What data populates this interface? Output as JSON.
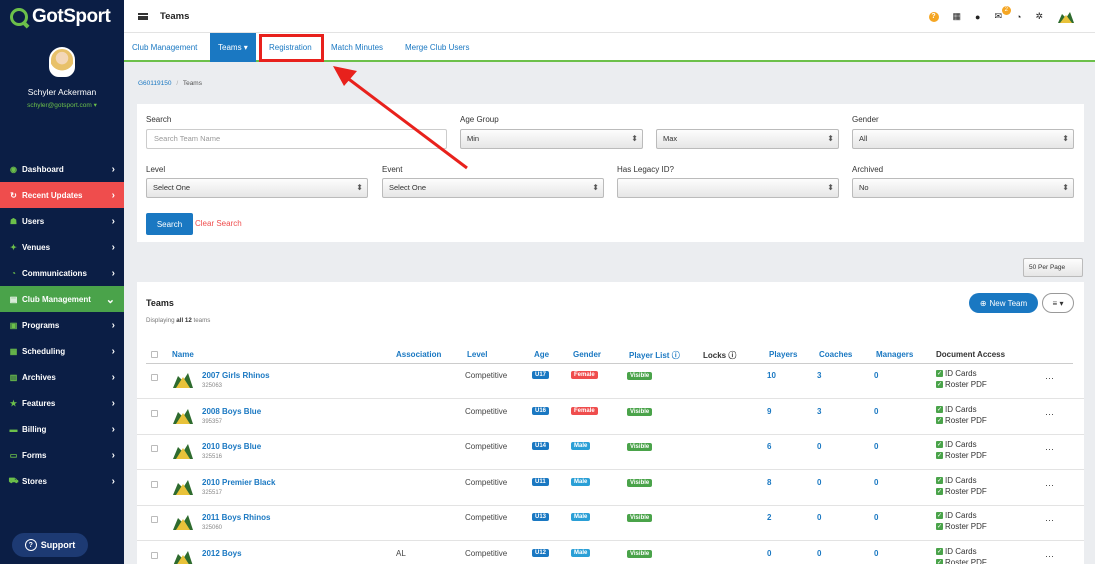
{
  "brand": {
    "logo_text": "GotSport",
    "accent": "#6cc04a"
  },
  "user": {
    "name": "Schyler Ackerman",
    "email": "schyler@gotsport.com ▾"
  },
  "sidebar": {
    "items": [
      {
        "label": "Dashboard",
        "icon": "dashboard-icon",
        "state": "normal"
      },
      {
        "label": "Recent Updates",
        "icon": "clock-icon",
        "state": "red"
      },
      {
        "label": "Users",
        "icon": "users-icon",
        "state": "normal"
      },
      {
        "label": "Venues",
        "icon": "venue-icon",
        "state": "normal"
      },
      {
        "label": "Communications",
        "icon": "chat-icon",
        "state": "normal"
      },
      {
        "label": "Club Management",
        "icon": "list-icon",
        "state": "green"
      },
      {
        "label": "Programs",
        "icon": "programs-icon",
        "state": "normal"
      },
      {
        "label": "Scheduling",
        "icon": "calendar-icon",
        "state": "normal"
      },
      {
        "label": "Archives",
        "icon": "archive-icon",
        "state": "normal"
      },
      {
        "label": "Features",
        "icon": "star-icon",
        "state": "normal"
      },
      {
        "label": "Billing",
        "icon": "billing-icon",
        "state": "normal"
      },
      {
        "label": "Forms",
        "icon": "forms-icon",
        "state": "normal"
      },
      {
        "label": "Stores",
        "icon": "cart-icon",
        "state": "normal"
      }
    ],
    "support_label": "Support"
  },
  "topbar": {
    "title": "Teams",
    "messages_badge": "2"
  },
  "subnav": {
    "tabs": [
      "Club Management",
      "Teams ▾",
      "Registration",
      "Match Minutes",
      "Merge Club Users"
    ]
  },
  "breadcrumb": {
    "root": "G60119150",
    "separator": "/",
    "current": "Teams"
  },
  "filters": {
    "search_label": "Search",
    "search_placeholder": "Search Team Name",
    "age_group_label": "Age Group",
    "age_min": "Min",
    "age_max": "Max",
    "gender_label": "Gender",
    "gender_value": "All",
    "level_label": "Level",
    "level_value": "Select One",
    "event_label": "Event",
    "event_value": "Select One",
    "legacy_label": "Has Legacy ID?",
    "legacy_value": "",
    "archived_label": "Archived",
    "archived_value": "No",
    "search_button": "Search",
    "clear_button": "Clear Search"
  },
  "per_page": "50 Per Page",
  "teams": {
    "title": "Teams",
    "displaying_prefix": "Displaying",
    "displaying_bold": "all 12",
    "displaying_suffix": "teams",
    "new_team_button": "New Team",
    "columns_button": "≡ ▾",
    "headers": {
      "name": "Name",
      "association": "Association",
      "level": "Level",
      "age": "Age",
      "gender": "Gender",
      "player_list": "Player List",
      "locks": "Locks",
      "players": "Players",
      "coaches": "Coaches",
      "managers": "Managers",
      "document_access": "Document Access"
    },
    "colors": {
      "female": "#ef4d4d",
      "male": "#2a9fd6",
      "visible": "#4aa34a",
      "age": "#1a78c2"
    },
    "rows": [
      {
        "name": "2007 Girls Rhinos",
        "id": "325063",
        "association": "",
        "level": "Competitive",
        "age": "U17",
        "gender": "Female",
        "player_list": "Visible",
        "players": "10",
        "coaches": "3",
        "managers": "0",
        "doc1": "ID Cards",
        "doc2": "Roster PDF"
      },
      {
        "name": "2008 Boys Blue",
        "id": "395357",
        "association": "",
        "level": "Competitive",
        "age": "U16",
        "gender": "Female",
        "player_list": "Visible",
        "players": "9",
        "coaches": "3",
        "managers": "0",
        "doc1": "ID Cards",
        "doc2": "Roster PDF"
      },
      {
        "name": "2010 Boys Blue",
        "id": "325516",
        "association": "",
        "level": "Competitive",
        "age": "U14",
        "gender": "Male",
        "player_list": "Visible",
        "players": "6",
        "coaches": "0",
        "managers": "0",
        "doc1": "ID Cards",
        "doc2": "Roster PDF"
      },
      {
        "name": "2010 Premier Black",
        "id": "325517",
        "association": "",
        "level": "Competitive",
        "age": "U11",
        "gender": "Male",
        "player_list": "Visible",
        "players": "8",
        "coaches": "0",
        "managers": "0",
        "doc1": "ID Cards",
        "doc2": "Roster PDF"
      },
      {
        "name": "2011 Boys Rhinos",
        "id": "325060",
        "association": "",
        "level": "Competitive",
        "age": "U13",
        "gender": "Male",
        "player_list": "Visible",
        "players": "2",
        "coaches": "0",
        "managers": "0",
        "doc1": "ID Cards",
        "doc2": "Roster PDF"
      },
      {
        "name": "2012 Boys",
        "id": "",
        "association": "AL",
        "level": "Competitive",
        "age": "U12",
        "gender": "Male",
        "player_list": "Visible",
        "players": "0",
        "coaches": "0",
        "managers": "0",
        "doc1": "ID Cards",
        "doc2": "Roster PDF"
      }
    ]
  },
  "annotation": {
    "color": "#e8211c"
  }
}
